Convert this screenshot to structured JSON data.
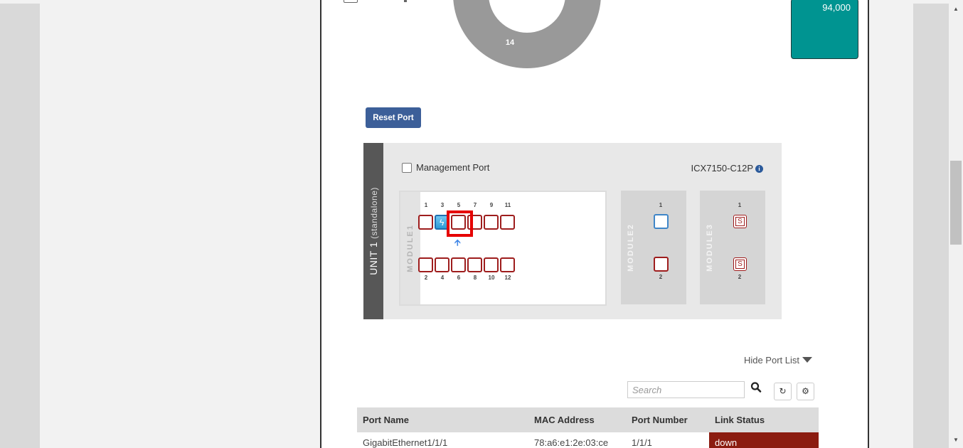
{
  "chart_widget": {
    "donut_label": "14",
    "tile_value": "94,000",
    "tile_color": "#009491"
  },
  "actions": {
    "reset_port_label": "Reset Port"
  },
  "unit": {
    "title": "UNIT 1",
    "subtitle": "(standalone)",
    "management_port_label": "Management Port",
    "management_port_checked": false,
    "model": "ICX7150-C12P",
    "modules": [
      {
        "label": "MODULE1",
        "top_ports": [
          "1",
          "3",
          "5",
          "7",
          "9",
          "11"
        ],
        "bottom_ports": [
          "2",
          "4",
          "6",
          "8",
          "10",
          "12"
        ],
        "active_port": "3"
      },
      {
        "label": "MODULE2",
        "top_ports": [
          "1"
        ],
        "bottom_ports": [
          "2"
        ]
      },
      {
        "label": "MODULE3",
        "top_ports": [
          "1"
        ],
        "bottom_ports": [
          "2"
        ],
        "port_glyph": "S"
      }
    ]
  },
  "port_list": {
    "toggle_label": "Hide Port List",
    "search_placeholder": "Search",
    "columns": [
      "Port Name",
      "MAC Address",
      "Port Number",
      "Link Status"
    ],
    "rows": [
      {
        "port_name": "GigabitEthernet1/1/1",
        "mac_address": "78:a6:e1:2e:03:ce",
        "port_number": "1/1/1",
        "link_status": "down"
      }
    ]
  },
  "colors": {
    "status_down": "#8b1c10",
    "port_border": "#9e1d1d",
    "active_port": "#2d9ad6",
    "highlight": "#e60000",
    "button_primary": "#3c5f99"
  }
}
